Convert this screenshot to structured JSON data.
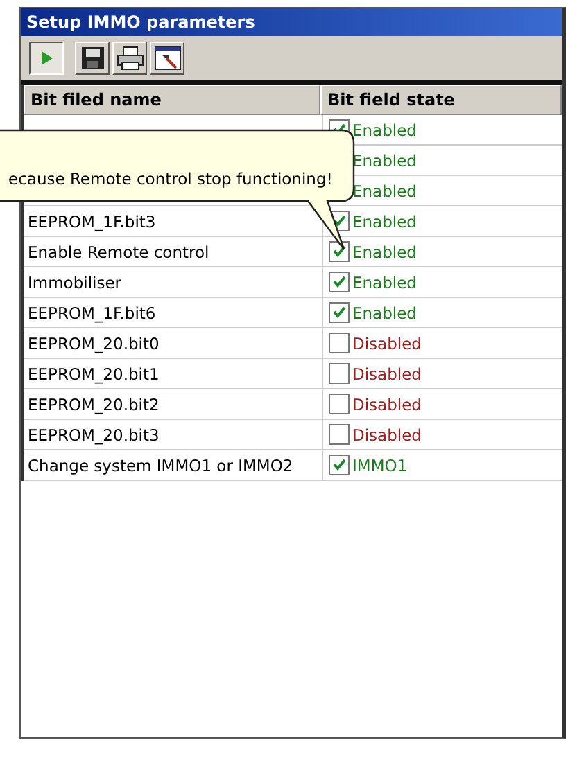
{
  "window": {
    "title": "Setup IMMO parameters"
  },
  "toolbar": [
    {
      "kind": "run",
      "selected": true
    },
    {
      "kind": "save",
      "selected": false
    },
    {
      "kind": "print",
      "selected": false
    },
    {
      "kind": "tool",
      "selected": false
    }
  ],
  "table": {
    "columns": [
      "Bit filed name",
      "Bit field state"
    ],
    "rows": [
      {
        "state": "Enabled",
        "checked": true
      },
      {
        "state": "Enabled"
      },
      {
        "state": "Enabled"
      },
      {
        "name": "EEPROM_1F.bit3",
        "state": "Enabled",
        "checked": true
      },
      {
        "name": "Enable Remote control",
        "state": "Enabled",
        "checked": true
      },
      {
        "name": "Immobiliser",
        "state": "Enabled",
        "checked": true
      },
      {
        "name": "EEPROM_1F.bit6",
        "state": "Enabled",
        "checked": true
      },
      {
        "name": "EEPROM_20.bit0",
        "state": "Disabled",
        "checked": false
      },
      {
        "name": "EEPROM_20.bit1",
        "state": "Disabled",
        "checked": false
      },
      {
        "name": "EEPROM_20.bit2",
        "state": "Disabled",
        "checked": false
      },
      {
        "name": "EEPROM_20.bit3",
        "state": "Disabled",
        "checked": false
      },
      {
        "name": "Change system IMMO1 or IMMO2",
        "state": "IMMO1",
        "checked": true
      }
    ]
  },
  "tooltip": {
    "text": "ecause Remote control stop functioning!"
  }
}
